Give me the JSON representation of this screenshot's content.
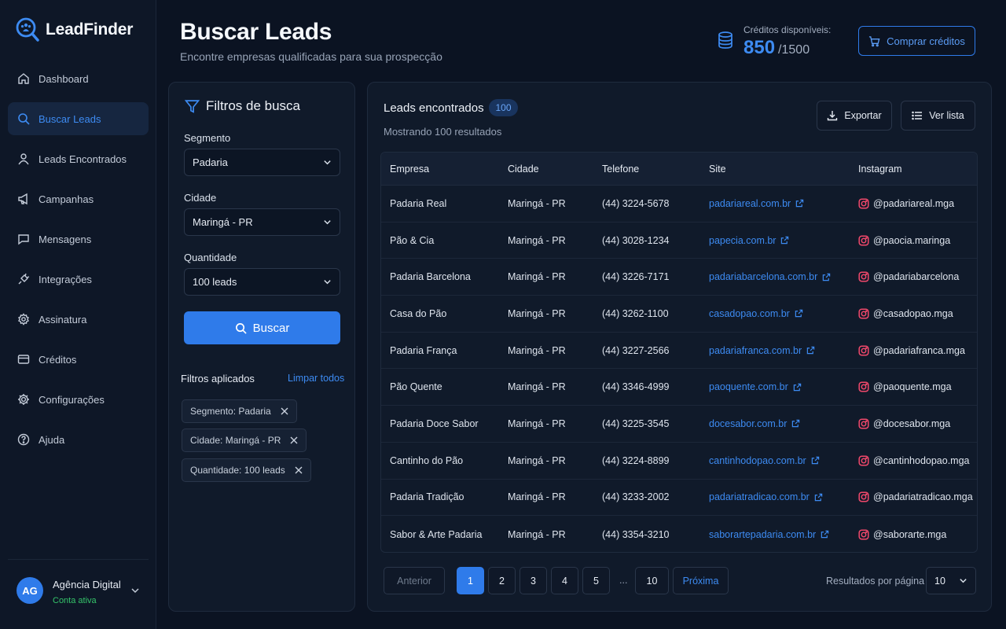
{
  "app": {
    "name": "LeadFinder"
  },
  "colors": {
    "accent": "#2f7bea",
    "link": "#3d8bf2",
    "success": "#35c46a",
    "background": "#0b1322"
  },
  "sidebar": {
    "items": [
      {
        "label": "Dashboard",
        "icon": "home-icon"
      },
      {
        "label": "Buscar Leads",
        "icon": "search-icon",
        "active": true
      },
      {
        "label": "Leads Encontrados",
        "icon": "user-icon"
      },
      {
        "label": "Campanhas",
        "icon": "megaphone-icon"
      },
      {
        "label": "Mensagens",
        "icon": "message-icon"
      },
      {
        "label": "Integrações",
        "icon": "plug-icon"
      },
      {
        "label": "Assinatura",
        "icon": "gear-badge-icon"
      },
      {
        "label": "Créditos",
        "icon": "card-icon"
      },
      {
        "label": "Configurações",
        "icon": "gear-icon"
      },
      {
        "label": "Ajuda",
        "icon": "help-icon"
      }
    ],
    "account": {
      "initials": "AG",
      "name": "Agência Digital",
      "status": "Conta ativa"
    }
  },
  "header": {
    "title": "Buscar Leads",
    "subtitle": "Encontre empresas qualificadas para sua prospecção",
    "credits_label": "Créditos disponíveis:",
    "credits_value": "850",
    "credits_total": "/1500",
    "buy_label": "Comprar créditos"
  },
  "filters": {
    "title": "Filtros de busca",
    "segment_label": "Segmento",
    "segment_value": "Padaria",
    "city_label": "Cidade",
    "city_value": "Maringá - PR",
    "quantity_label": "Quantidade",
    "quantity_value": "100 leads",
    "search_label": "Buscar",
    "applied_title": "Filtros aplicados",
    "clear_label": "Limpar todos",
    "chips": [
      "Segmento: Padaria",
      "Cidade: Maringá - PR",
      "Quantidade: 100 leads"
    ]
  },
  "results": {
    "title": "Leads encontrados",
    "count_badge": "100",
    "subtitle": "Mostrando 100 resultados",
    "export_label": "Exportar",
    "list_label": "Ver lista",
    "columns": [
      "Empresa",
      "Cidade",
      "Telefone",
      "Site",
      "Instagram"
    ],
    "rows": [
      [
        "Padaria Real",
        "Maringá - PR",
        "(44) 3224-5678",
        "padariareal.com.br",
        "@padariareal.mga"
      ],
      [
        "Pão & Cia",
        "Maringá - PR",
        "(44) 3028-1234",
        "papecia.com.br",
        "@paocia.maringa"
      ],
      [
        "Padaria Barcelona",
        "Maringá - PR",
        "(44) 3226-7171",
        "padariabarcelona.com.br",
        "@padariabarcelona"
      ],
      [
        "Casa do Pão",
        "Maringá - PR",
        "(44) 3262-1100",
        "casadopao.com.br",
        "@casadopao.mga"
      ],
      [
        "Padaria França",
        "Maringá - PR",
        "(44) 3227-2566",
        "padariafranca.com.br",
        "@padariafranca.mga"
      ],
      [
        "Pão Quente",
        "Maringá - PR",
        "(44) 3346-4999",
        "paoquente.com.br",
        "@paoquente.mga"
      ],
      [
        "Padaria Doce Sabor",
        "Maringá - PR",
        "(44) 3225-3545",
        "docesabor.com.br",
        "@docesabor.mga"
      ],
      [
        "Cantinho do Pão",
        "Maringá - PR",
        "(44) 3224-8899",
        "cantinhodopao.com.br",
        "@cantinhodopao.mga"
      ],
      [
        "Padaria Tradição",
        "Maringá - PR",
        "(44) 3233-2002",
        "padariatradicao.com.br",
        "@padariatradicao.mga"
      ],
      [
        "Sabor & Arte Padaria",
        "Maringá - PR",
        "(44) 3354-3210",
        "saborartepadaria.com.br",
        "@saborarte.mga"
      ]
    ]
  },
  "pagination": {
    "prev_label": "Anterior",
    "pages": [
      "1",
      "2",
      "3",
      "4",
      "5"
    ],
    "current_page": "1",
    "ellipsis": "...",
    "last_page": "10",
    "next_label": "Próxima",
    "per_page_label": "Resultados por página",
    "per_page_value": "10"
  }
}
